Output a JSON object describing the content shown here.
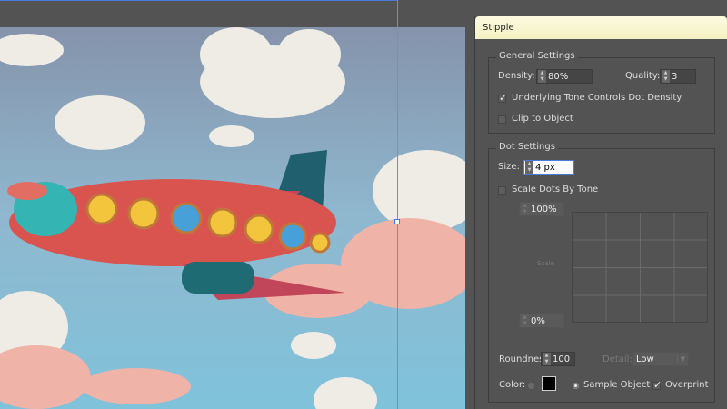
{
  "dialog": {
    "title": "Stipple",
    "general": {
      "legend": "General Settings",
      "density_label": "Density:",
      "density_value": "80%",
      "quality_label": "Quality:",
      "quality_value": "3",
      "tone_label": "Underlying Tone Controls Dot Density",
      "tone_checked": true,
      "clip_label": "Clip to Object",
      "clip_checked": false
    },
    "dot": {
      "legend": "Dot Settings",
      "size_label": "Size:",
      "size_value": "4 px",
      "scale_by_tone_label": "Scale Dots By Tone",
      "scale_max": "100%",
      "scale_min": "0%",
      "scale_axis_label": "Scale",
      "roundness_label": "Roundness:",
      "roundness_value": "100",
      "detail_label": "Detail:",
      "detail_value": "Low",
      "color_label": "Color:",
      "sample_label": "Sample Object",
      "overprint_label": "Overprint",
      "overprint_checked": true
    }
  }
}
